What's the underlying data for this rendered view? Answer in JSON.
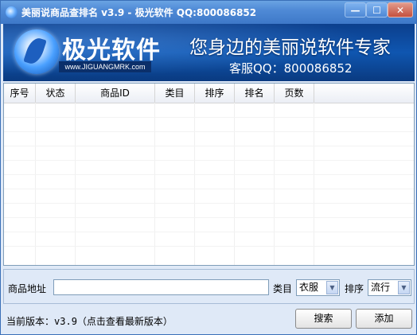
{
  "window": {
    "title": "美丽说商品查排名 v3.9 - 极光软件 QQ:800086852",
    "min_glyph": "—",
    "max_glyph": "☐",
    "close_glyph": "✕"
  },
  "banner": {
    "brand_name": "极光软件",
    "brand_url": "www.JIGUANGMRK.com",
    "slogan": "您身边的美丽说软件专家",
    "service": "客服QQ：800086852"
  },
  "table": {
    "columns": [
      "序号",
      "状态",
      "商品ID",
      "类目",
      "排序",
      "排名",
      "页数"
    ],
    "rows": []
  },
  "form": {
    "address_label": "商品地址",
    "address_value": "",
    "category_label": "类目",
    "category_value": "衣服",
    "sort_label": "排序",
    "sort_value": "流行",
    "search_button": "搜索",
    "add_button": "添加"
  },
  "status": {
    "version_label": "当前版本：",
    "version_value": "v3.9",
    "version_hint": "（点击查看最新版本）"
  },
  "colors": {
    "titlebar": "#4f8ad6",
    "banner": "#0f56b0",
    "window_bg": "#dfe9f7"
  }
}
